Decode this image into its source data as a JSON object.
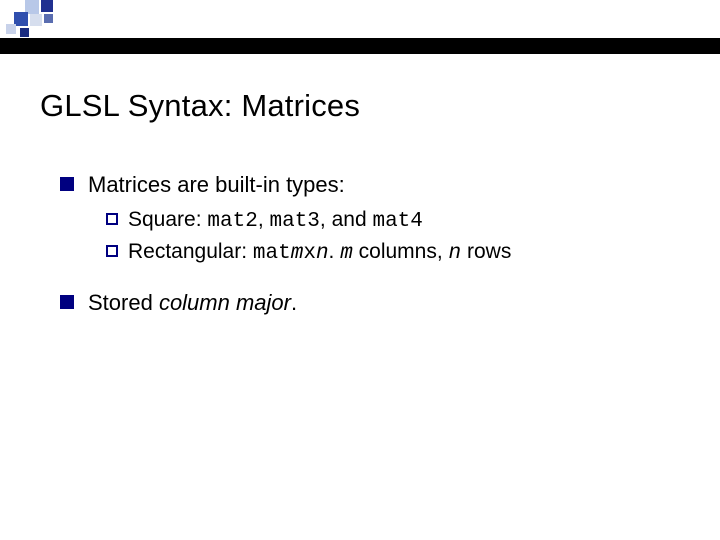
{
  "title": "GLSL Syntax:  Matrices",
  "l1a": "Matrices are built-in types:",
  "sq_label": "Square:",
  "sq_c1": "mat2",
  "sq_sep1": ", ",
  "sq_c2": "mat3",
  "sq_sep2": ", and ",
  "sq_c3": "mat4",
  "rect_label": "Rectangular: ",
  "rect_code_pre": "mat",
  "rect_m": "m",
  "rect_x": "x",
  "rect_n": "n",
  "rect_after1": ".  ",
  "rect_m2": "m",
  "rect_after2": " columns, ",
  "rect_n2": "n",
  "rect_after3": " rows",
  "l1b_pre": "Stored ",
  "l1b_em": "column major",
  "l1b_post": "."
}
